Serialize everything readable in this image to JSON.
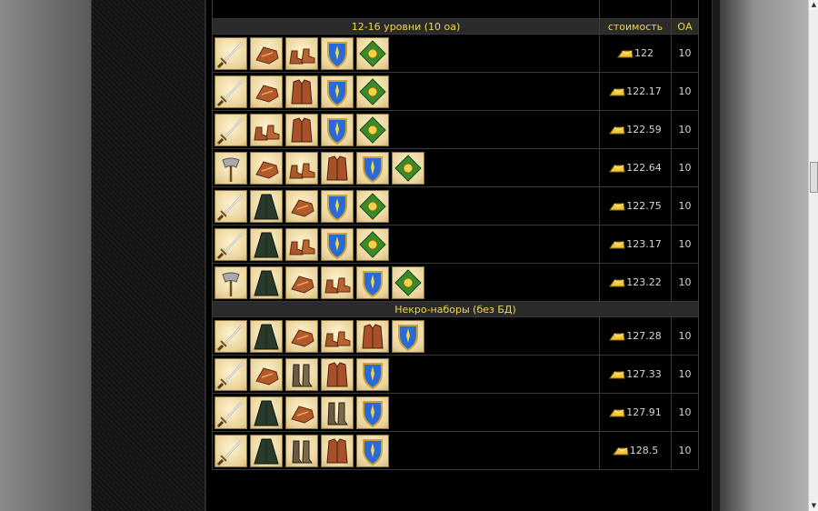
{
  "table": {
    "group1": {
      "title": "12-16 уровни (10 оа)",
      "cost_header": "стоимость",
      "oa_header": "ОА"
    },
    "group2": {
      "title": "Некро-наборы (без БД)"
    }
  },
  "rows": [
    {
      "items": [
        "sword-icon",
        "gloves-icon",
        "boots-icon",
        "shield-icon",
        "amulet-icon"
      ],
      "cost": "122",
      "oa": "10"
    },
    {
      "items": [
        "sword-icon",
        "gloves-icon",
        "leather-vest-icon",
        "shield-icon",
        "amulet-icon"
      ],
      "cost": "122.17",
      "oa": "10"
    },
    {
      "items": [
        "sword-icon",
        "boots-icon",
        "leather-vest-icon",
        "shield-icon",
        "amulet-icon"
      ],
      "cost": "122.59",
      "oa": "10"
    },
    {
      "items": [
        "axe-icon",
        "gloves-icon",
        "boots-icon",
        "leather-vest-icon",
        "shield-icon",
        "amulet-icon"
      ],
      "cost": "122.64",
      "oa": "10"
    },
    {
      "items": [
        "sword-icon",
        "cloak-icon",
        "gloves-icon",
        "shield-icon",
        "amulet-icon"
      ],
      "cost": "122.75",
      "oa": "10"
    },
    {
      "items": [
        "sword-icon",
        "cloak-icon",
        "boots-icon",
        "shield-icon",
        "amulet-icon"
      ],
      "cost": "123.17",
      "oa": "10"
    },
    {
      "items": [
        "axe-icon",
        "cloak-icon",
        "gloves-icon",
        "boots-icon",
        "shield-icon",
        "amulet-icon"
      ],
      "cost": "123.22",
      "oa": "10"
    },
    {
      "items": [
        "sword-icon",
        "cloak-icon",
        "gloves-icon",
        "boots-icon",
        "leather-vest-icon",
        "shield-icon"
      ],
      "cost": "127.28",
      "oa": "10"
    },
    {
      "items": [
        "sword-icon",
        "gloves-icon",
        "high-boots-icon",
        "leather-vest-icon",
        "shield-icon"
      ],
      "cost": "127.33",
      "oa": "10"
    },
    {
      "items": [
        "sword-icon",
        "cloak-icon",
        "gloves-icon",
        "high-boots-icon",
        "shield-icon"
      ],
      "cost": "127.91",
      "oa": "10"
    },
    {
      "items": [
        "sword-icon",
        "cloak-icon",
        "high-boots-icon",
        "leather-vest-icon",
        "shield-icon"
      ],
      "cost": "128.5",
      "oa": "10"
    }
  ],
  "colors": {
    "header_text": "#f2d64a",
    "header_bg": "#2a2a2a",
    "cell_text": "#d6d6d6",
    "icon_bg": "#e9d29a"
  }
}
